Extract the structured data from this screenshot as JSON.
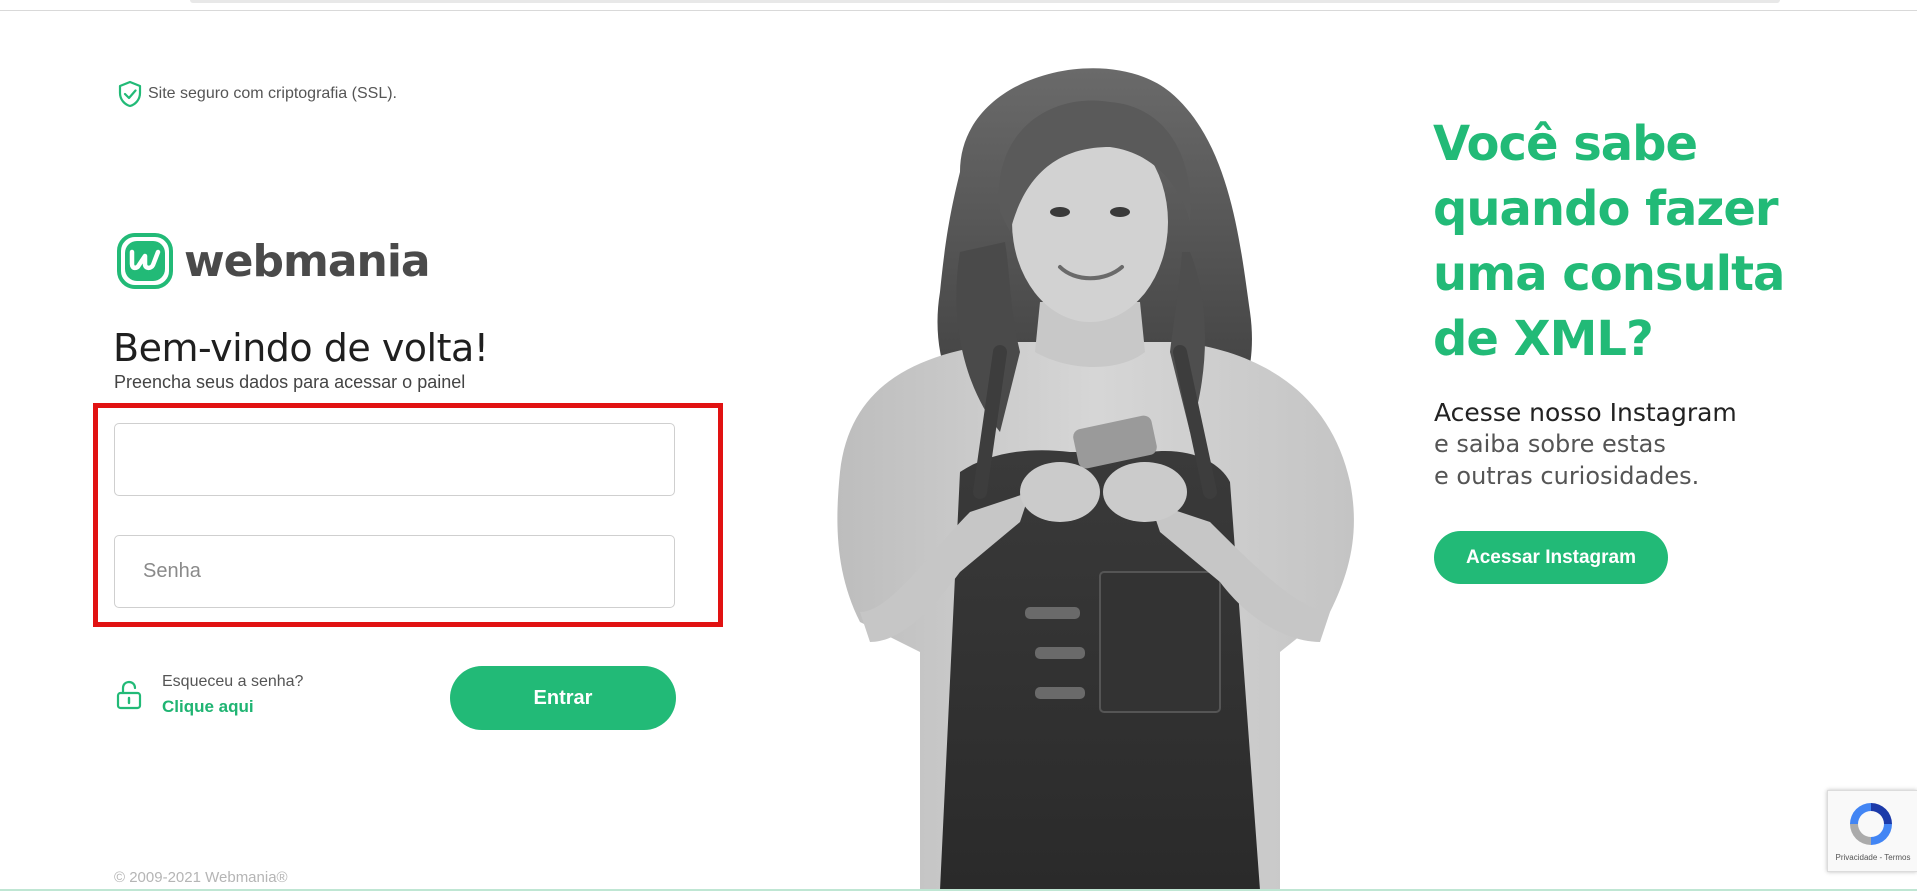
{
  "ssl_notice": "Site seguro com criptografia (SSL).",
  "brand": {
    "name": "webmania",
    "color": "#22ba77"
  },
  "login": {
    "welcome": "Bem-vindo de volta!",
    "subtitle": "Preencha seus dados para acessar o painel",
    "user_value": "",
    "password_placeholder": "Senha",
    "forgot_question": "Esqueceu a senha?",
    "forgot_link": "Clique aqui",
    "submit_label": "Entrar"
  },
  "promo": {
    "title": "Você sabe quando fazer uma consulta de XML?",
    "lead": "Acesse nosso Instagram",
    "line1": "e saiba sobre estas",
    "line2": "e outras curiosidades.",
    "button_label": "Acessar Instagram"
  },
  "footer": {
    "copyright": "© 2009-2021 Webmania®"
  },
  "recaptcha": {
    "text": "Privacidade - Termos"
  },
  "icons": {
    "ssl": "shield-check-icon",
    "lock": "unlock-icon",
    "recaptcha": "recaptcha-icon"
  }
}
